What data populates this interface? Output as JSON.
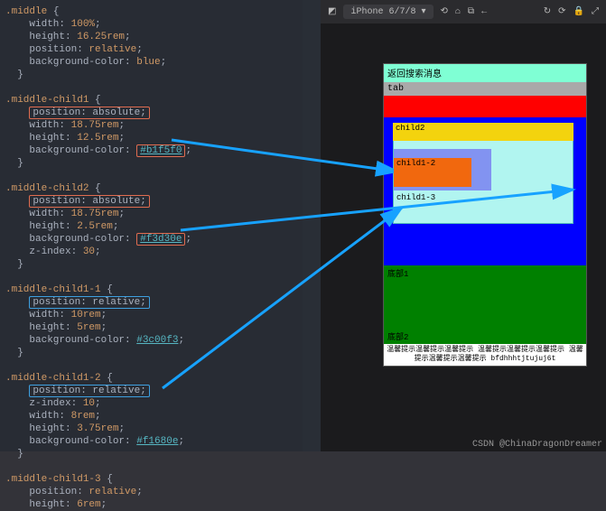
{
  "code": {
    "s1": {
      "sel": ".middle",
      "p1": "width",
      "v1": "100%",
      "p2": "height",
      "v2": "16.25rem",
      "p3": "position",
      "v3": "relative",
      "p4": "background-color",
      "v4": "blue"
    },
    "s2": {
      "sel": ".middle-child1",
      "pos": "position: absolute;",
      "p1": "width",
      "v1": "18.75rem",
      "p2": "height",
      "v2": "12.5rem",
      "p3": "background-color",
      "v3": "#b1f5f0"
    },
    "s3": {
      "sel": ".middle-child2",
      "pos": "position: absolute;",
      "p1": "width",
      "v1": "18.75rem",
      "p2": "height",
      "v2": "2.5rem",
      "p3": "background-color",
      "v3": "#f3d30e",
      "p4": "z-index",
      "v4": "30"
    },
    "s4": {
      "sel": ".middle-child1-1",
      "pos": "position: relative;",
      "p1": "width",
      "v1": "10rem",
      "p2": "height",
      "v2": "5rem",
      "p3": "background-color",
      "v3": "#3c00f3"
    },
    "s5": {
      "sel": ".middle-child1-2",
      "pos": "position: relative;",
      "p1": "z-index",
      "v1": "10",
      "p2": "width",
      "v2": "8rem",
      "p3": "height",
      "v3": "3.75rem",
      "p4": "background-color",
      "v4": "#f1680e"
    },
    "s6": {
      "sel": ".middle-child1-3",
      "p1": "position",
      "v1": "relative",
      "p2": "height",
      "v2": "6rem"
    }
  },
  "devbar": {
    "device": "iPhone 6/7/8",
    "zoom": "▾",
    "icons": {
      "rotate": "⟲",
      "home": "⌂",
      "screenshot": "⧉",
      "back": "←",
      "reload": "↻",
      "refresh": "⟳",
      "lock": "🔒",
      "expand": "⤢"
    }
  },
  "preview": {
    "back": "返回搜索消息",
    "tab": "tab",
    "child2": "child2",
    "child12": "child1-2",
    "child13": "child1-3",
    "bottom1": "底部1",
    "bottom2": "底部2",
    "tip": "温馨提示温馨提示温馨提示 温馨提示温馨提示温馨提示\n温馨提示温馨提示温馨提示 bfdhhhtjtujuj6t"
  },
  "watermark": "CSDN @ChinaDragonDreamer"
}
